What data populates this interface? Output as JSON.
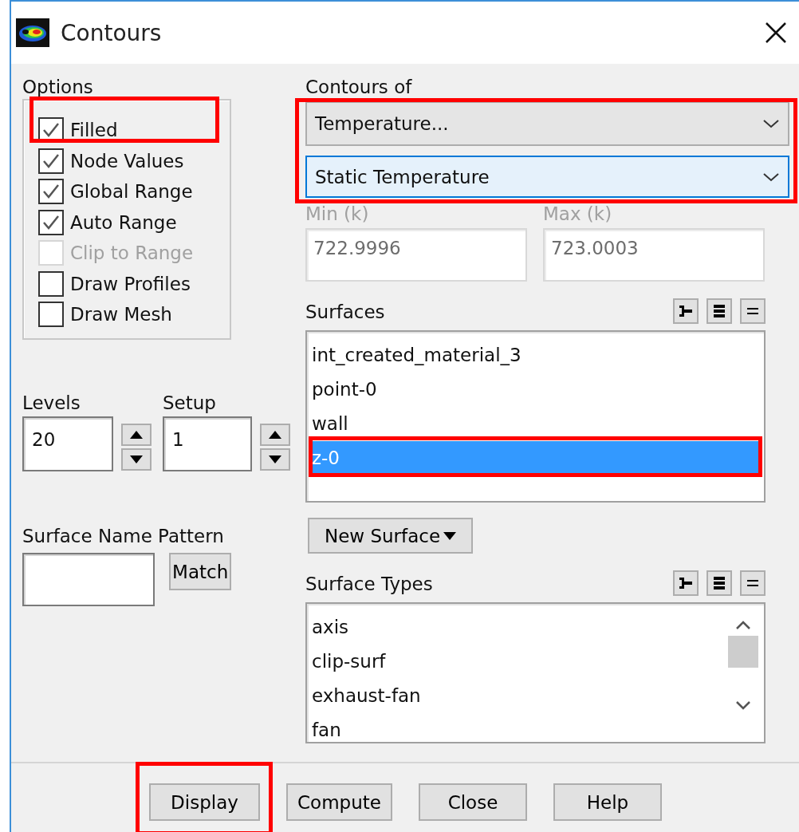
{
  "window": {
    "title": "Contours"
  },
  "options": {
    "label": "Options",
    "items": [
      {
        "label": "Filled",
        "checked": true,
        "disabled": false,
        "highlighted": true
      },
      {
        "label": "Node Values",
        "checked": true,
        "disabled": false,
        "highlighted": false
      },
      {
        "label": "Global Range",
        "checked": true,
        "disabled": false,
        "highlighted": false
      },
      {
        "label": "Auto Range",
        "checked": true,
        "disabled": false,
        "highlighted": false
      },
      {
        "label": "Clip to Range",
        "checked": false,
        "disabled": true,
        "highlighted": false
      },
      {
        "label": "Draw Profiles",
        "checked": false,
        "disabled": false,
        "highlighted": false
      },
      {
        "label": "Draw Mesh",
        "checked": false,
        "disabled": false,
        "highlighted": false
      }
    ]
  },
  "contours_of": {
    "label": "Contours of",
    "highlighted": true,
    "category": "Temperature...",
    "quantity": "Static Temperature"
  },
  "min": {
    "label": "Min (k)",
    "value": "722.9996",
    "disabled": true
  },
  "max": {
    "label": "Max (k)",
    "value": "723.0003",
    "disabled": true
  },
  "surfaces": {
    "label": "Surfaces",
    "items": [
      {
        "label": "int_created_material_3",
        "selected": false,
        "highlighted": false
      },
      {
        "label": "point-0",
        "selected": false,
        "highlighted": false
      },
      {
        "label": "wall",
        "selected": false,
        "highlighted": false
      },
      {
        "label": "z-0",
        "selected": true,
        "highlighted": true
      }
    ]
  },
  "levels": {
    "label": "Levels",
    "value": "20"
  },
  "setup": {
    "label": "Setup",
    "value": "1"
  },
  "surface_name_pattern": {
    "label": "Surface Name Pattern",
    "button": "Match"
  },
  "new_surface": {
    "label": "New Surface"
  },
  "surface_types": {
    "label": "Surface Types",
    "items": [
      {
        "label": "axis",
        "selected": false
      },
      {
        "label": "clip-surf",
        "selected": false
      },
      {
        "label": "exhaust-fan",
        "selected": false
      },
      {
        "label": "fan",
        "selected": false
      }
    ]
  },
  "buttons": [
    {
      "label": "Display",
      "highlighted": true
    },
    {
      "label": "Compute",
      "highlighted": false
    },
    {
      "label": "Close",
      "highlighted": false
    },
    {
      "label": "Help",
      "highlighted": false
    }
  ]
}
